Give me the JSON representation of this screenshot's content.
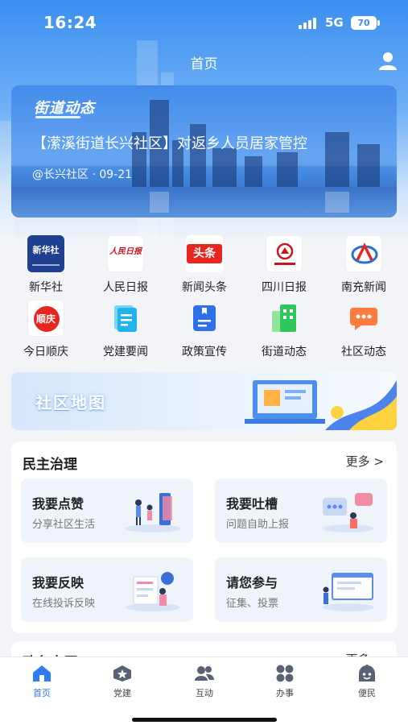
{
  "status": {
    "time": "16:24",
    "network": "5G",
    "battery": "70"
  },
  "header": {
    "title": "首页",
    "profile_icon": "user-icon"
  },
  "banner": {
    "brand": "街道动态",
    "headline": "【潆溪街道长兴社区】对返乡人员居家管控",
    "meta": "@长兴社区 · 09-21"
  },
  "apps": [
    {
      "label": "新华社",
      "icon": "xinhua-logo"
    },
    {
      "label": "人民日报",
      "icon": "peoples-daily-logo"
    },
    {
      "label": "新闻头条",
      "icon": "toutiao-logo"
    },
    {
      "label": "四川日报",
      "icon": "sichuan-daily-logo"
    },
    {
      "label": "南充新闻",
      "icon": "nanchong-news-logo"
    },
    {
      "label": "今日顺庆",
      "icon": "shunqing-logo"
    },
    {
      "label": "党建要闻",
      "icon": "document-icon"
    },
    {
      "label": "政策宣传",
      "icon": "file-icon"
    },
    {
      "label": "街道动态",
      "icon": "building-icon"
    },
    {
      "label": "社区动态",
      "icon": "chat-bubble-icon"
    }
  ],
  "app_logos": {
    "xinhua": "新华社",
    "peoples_daily": "人民日报",
    "toutiao": "头条",
    "shunqing": "顺庆"
  },
  "map_banner": {
    "title": "社区地图"
  },
  "governance": {
    "title": "民主治理",
    "more": "更多 >",
    "cards": [
      {
        "title": "我要点赞",
        "subtitle": "分享社区生活"
      },
      {
        "title": "我要吐槽",
        "subtitle": "问题自助上报"
      },
      {
        "title": "我要反映",
        "subtitle": "在线投诉反映"
      },
      {
        "title": "请您参与",
        "subtitle": "征集、投票"
      }
    ]
  },
  "section2": {
    "title": "政务大厅",
    "more": "更多 >"
  },
  "tabbar": [
    {
      "label": "首页",
      "icon": "home-icon",
      "active": true
    },
    {
      "label": "党建",
      "icon": "party-star-icon"
    },
    {
      "label": "互动",
      "icon": "people-icon"
    },
    {
      "label": "办事",
      "icon": "grid-icon"
    },
    {
      "label": "便民",
      "icon": "service-icon"
    }
  ],
  "colors": {
    "primary": "#2f7cf0",
    "hero": "#3b8ef0",
    "card_bg": "#eff4fb"
  }
}
